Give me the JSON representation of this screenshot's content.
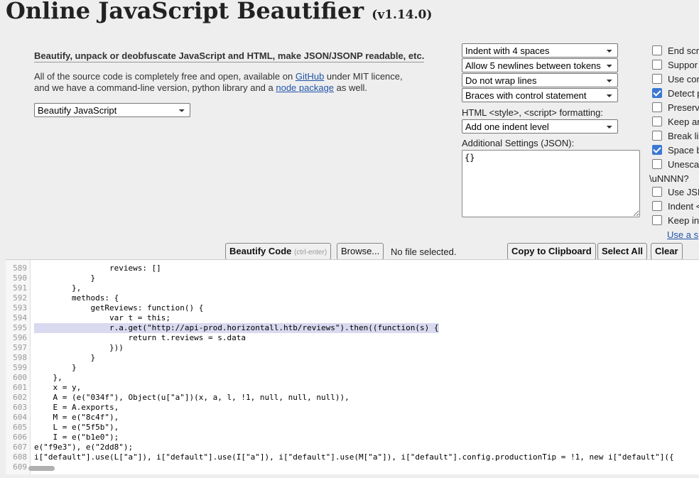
{
  "header": {
    "title": "Online JavaScript Beautifier",
    "version": "(v1.14.0)"
  },
  "intro": {
    "tagline": "Beautify, unpack or deobfuscate JavaScript and HTML, make JSON/JSONP readable, etc.",
    "line1_prefix": "All of the source code is completely free and open, available on ",
    "github_link": "GitHub",
    "line1_suffix": " under MIT licence,",
    "line2_prefix": "and we have a command-line version, python library and a ",
    "node_link": "node package",
    "line2_suffix": " as well."
  },
  "mode_select": {
    "value": "Beautify JavaScript"
  },
  "options": {
    "indent": "Indent with 4 spaces",
    "newlines": "Allow 5 newlines between tokens",
    "wrap": "Do not wrap lines",
    "braces": "Braces with control statement",
    "html_label": "HTML <style>, <script> formatting:",
    "html_indent": "Add one indent level",
    "additional_label": "Additional Settings (JSON):",
    "additional_value": "{}"
  },
  "checkboxes": [
    {
      "label": "End scr",
      "checked": false
    },
    {
      "label": "Suppor",
      "checked": false
    },
    {
      "label": "Use cor",
      "checked": false
    },
    {
      "label": "Detect p",
      "checked": true
    },
    {
      "label": "Preserv",
      "checked": false
    },
    {
      "label": "Keep ar",
      "checked": false
    },
    {
      "label": "Break li",
      "checked": false
    },
    {
      "label": "Space b",
      "checked": true
    },
    {
      "label": "Unesca",
      "checked": false
    }
  ],
  "unescape_tail": "\\uNNNN?",
  "checkboxes2": [
    {
      "label": "Use JSI",
      "checked": false
    },
    {
      "label": "Indent <",
      "checked": false
    },
    {
      "label": "Keep in",
      "checked": false
    }
  ],
  "use_link": "Use a s",
  "toolbar": {
    "beautify": "Beautify Code",
    "beautify_hint": "(ctrl-enter)",
    "browse": "Browse...",
    "nofile": "No file selected.",
    "copy": "Copy to Clipboard",
    "select_all": "Select All",
    "clear": "Clear"
  },
  "code_lines": [
    {
      "n": "589",
      "t": "                reviews: []"
    },
    {
      "n": "590",
      "t": "            }"
    },
    {
      "n": "591",
      "t": "        },"
    },
    {
      "n": "592",
      "t": "        methods: {"
    },
    {
      "n": "593",
      "t": "            getReviews: function() {"
    },
    {
      "n": "594",
      "t": "                var t = this;"
    },
    {
      "n": "595",
      "t": "                r.a.get(\"http://api-prod.horizontall.htb/reviews\").then((function(s) {"
    },
    {
      "n": "596",
      "t": "                    return t.reviews = s.data"
    },
    {
      "n": "597",
      "t": "                }))"
    },
    {
      "n": "598",
      "t": "            }"
    },
    {
      "n": "599",
      "t": "        }"
    },
    {
      "n": "600",
      "t": "    },"
    },
    {
      "n": "601",
      "t": "    x = y,"
    },
    {
      "n": "602",
      "t": "    A = (e(\"034f\"), Object(u[\"a\"])(x, a, l, !1, null, null, null)),"
    },
    {
      "n": "603",
      "t": "    E = A.exports,"
    },
    {
      "n": "604",
      "t": "    M = e(\"8c4f\"),"
    },
    {
      "n": "605",
      "t": "    L = e(\"5f5b\"),"
    },
    {
      "n": "606",
      "t": "    I = e(\"b1e0\");"
    },
    {
      "n": "607",
      "t": "e(\"f9e3\"), e(\"2dd8\");"
    },
    {
      "n": "608",
      "t": "i[\"default\"].use(L[\"a\"]), i[\"default\"].use(I[\"a\"]), i[\"default\"].use(M[\"a\"]), i[\"default\"].config.productionTip = !1, new i[\"default\"]({"
    },
    {
      "n": "609",
      "t": ""
    }
  ],
  "highlight_line": "595"
}
